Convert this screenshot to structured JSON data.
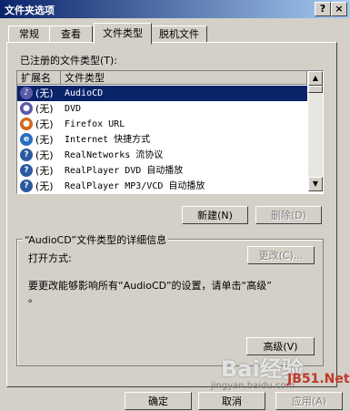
{
  "window": {
    "title": "文件夹选项",
    "help_glyph": "?",
    "close_glyph": "×"
  },
  "tabs": [
    "常规",
    "查看",
    "文件类型",
    "脱机文件"
  ],
  "file_types": {
    "label": "已注册的文件类型(T):",
    "columns": [
      "扩展名",
      "文件类型"
    ],
    "rows": [
      {
        "ext": "(无)",
        "type": "AudioCD",
        "icon": "cd-audio-icon",
        "color": "#5a5aa8",
        "selected": true
      },
      {
        "ext": "(无)",
        "type": "DVD",
        "icon": "dvd-icon",
        "color": "#5a5aa8"
      },
      {
        "ext": "(无)",
        "type": "Firefox URL",
        "icon": "firefox-icon",
        "color": "#d2691e"
      },
      {
        "ext": "(无)",
        "type": "Internet 快捷方式",
        "icon": "internet-shortcut-icon",
        "color": "#2a6fbf"
      },
      {
        "ext": "(无)",
        "type": "RealNetworks 流协议",
        "icon": "realplayer-icon",
        "color": "#2c5aa0"
      },
      {
        "ext": "(无)",
        "type": "RealPlayer DVD 自动播放",
        "icon": "realplayer-icon",
        "color": "#2c5aa0"
      },
      {
        "ext": "(无)",
        "type": "RealPlayer MP3/VCD 自动播放",
        "icon": "realplayer-icon",
        "color": "#2c5aa0"
      }
    ]
  },
  "buttons": {
    "new": "新建(N)",
    "delete": "删除(D)",
    "change": "更改(C)...",
    "advanced": "高级(V)",
    "ok": "确定",
    "cancel": "取消",
    "apply": "应用(A)"
  },
  "details": {
    "title": "“AudioCD”文件类型的详细信息",
    "opens_with_label": "打开方式:",
    "description": "要更改能够影响所有“AudioCD”的设置，请单击“高级”",
    "description_end": "。"
  },
  "watermark": {
    "brand": "Bai经验",
    "url": "jingyan.baidu.com",
    "site": "JB51.Net"
  }
}
